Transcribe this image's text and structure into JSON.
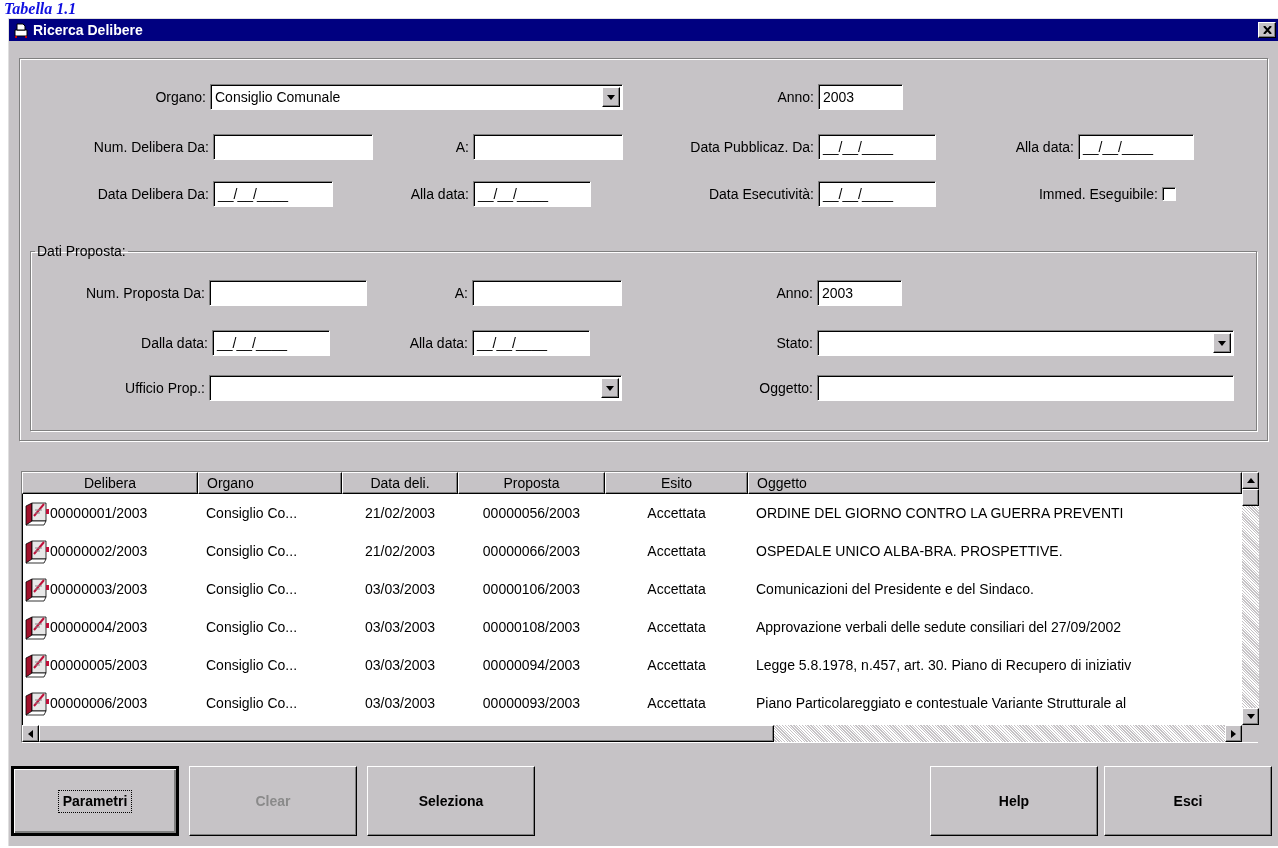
{
  "caption": "Tabella 1.1",
  "window": {
    "title": "Ricerca Delibere"
  },
  "form": {
    "rows": [
      [
        {
          "label": "Organo:",
          "kind": "combo",
          "value": "Consiglio Comunale"
        },
        null,
        {
          "label": "Anno:",
          "kind": "text",
          "value": "2003"
        }
      ],
      [
        {
          "label": "Num. Delibera Da:",
          "kind": "text"
        },
        {
          "label": "A:",
          "kind": "text"
        },
        {
          "label": "Data Pubblicaz. Da:",
          "kind": "text",
          "value": "__/__/____"
        },
        {
          "label": "Alla data:",
          "kind": "text",
          "value": "__/__/____"
        }
      ],
      [
        {
          "label": "Data Delibera Da:",
          "kind": "text",
          "value": "__/__/____"
        },
        {
          "label": "Alla data:",
          "kind": "text",
          "value": "__/__/____"
        },
        {
          "label": "Data Esecutività:",
          "kind": "text",
          "value": "__/__/____"
        },
        {
          "label": "Immed. Eseguibile:",
          "kind": "checkbox",
          "checked": false
        }
      ]
    ]
  },
  "proposal_group": {
    "title": "Dati Proposta:",
    "rows": [
      [
        {
          "label": "Num. Proposta Da:",
          "kind": "text"
        },
        {
          "label": "A:",
          "kind": "text"
        },
        {
          "label": "Anno:",
          "kind": "text",
          "value": "2003"
        }
      ],
      [
        {
          "label": "Dalla data:",
          "kind": "text",
          "value": "__/__/____"
        },
        {
          "label": "Alla data:",
          "kind": "text",
          "value": "__/__/____"
        },
        {
          "label": "Stato:",
          "kind": "combo"
        }
      ],
      [
        {
          "label": "Ufficio Prop.:",
          "kind": "combo"
        },
        null,
        {
          "label": "Oggetto:",
          "kind": "text"
        }
      ]
    ]
  },
  "table": {
    "columns": [
      "Delibera",
      "Organo",
      "Data deli.",
      "Proposta",
      "Esito",
      "Oggetto"
    ],
    "rows": [
      [
        "00000001/2003",
        "Consiglio Co...",
        "21/02/2003",
        "00000056/2003",
        "Accettata",
        "ORDINE DEL GIORNO CONTRO LA GUERRA PREVENTI"
      ],
      [
        "00000002/2003",
        "Consiglio Co...",
        "21/02/2003",
        "00000066/2003",
        "Accettata",
        "OSPEDALE UNICO ALBA-BRA. PROSPETTIVE."
      ],
      [
        "00000003/2003",
        "Consiglio Co...",
        "03/03/2003",
        "00000106/2003",
        "Accettata",
        "Comunicazioni del Presidente e del Sindaco."
      ],
      [
        "00000004/2003",
        "Consiglio Co...",
        "03/03/2003",
        "00000108/2003",
        "Accettata",
        "Approvazione verbali delle sedute consiliari del 27/09/2002"
      ],
      [
        "00000005/2003",
        "Consiglio Co...",
        "03/03/2003",
        "00000094/2003",
        "Accettata",
        "Legge 5.8.1978, n.457, art. 30. Piano di Recupero di iniziativ"
      ],
      [
        "00000006/2003",
        "Consiglio Co...",
        "03/03/2003",
        "00000093/2003",
        "Accettata",
        "Piano Particolareggiato e contestuale Variante Strutturale al"
      ]
    ]
  },
  "buttons_left": [
    {
      "label": "Parametri",
      "disabled": false,
      "focused": true
    },
    {
      "label": "Clear",
      "disabled": true,
      "focused": false
    },
    {
      "label": "Seleziona",
      "disabled": false,
      "focused": false
    }
  ],
  "buttons_right": [
    {
      "label": "Help",
      "disabled": false,
      "focused": false
    },
    {
      "label": "Esci",
      "disabled": false,
      "focused": false
    }
  ]
}
